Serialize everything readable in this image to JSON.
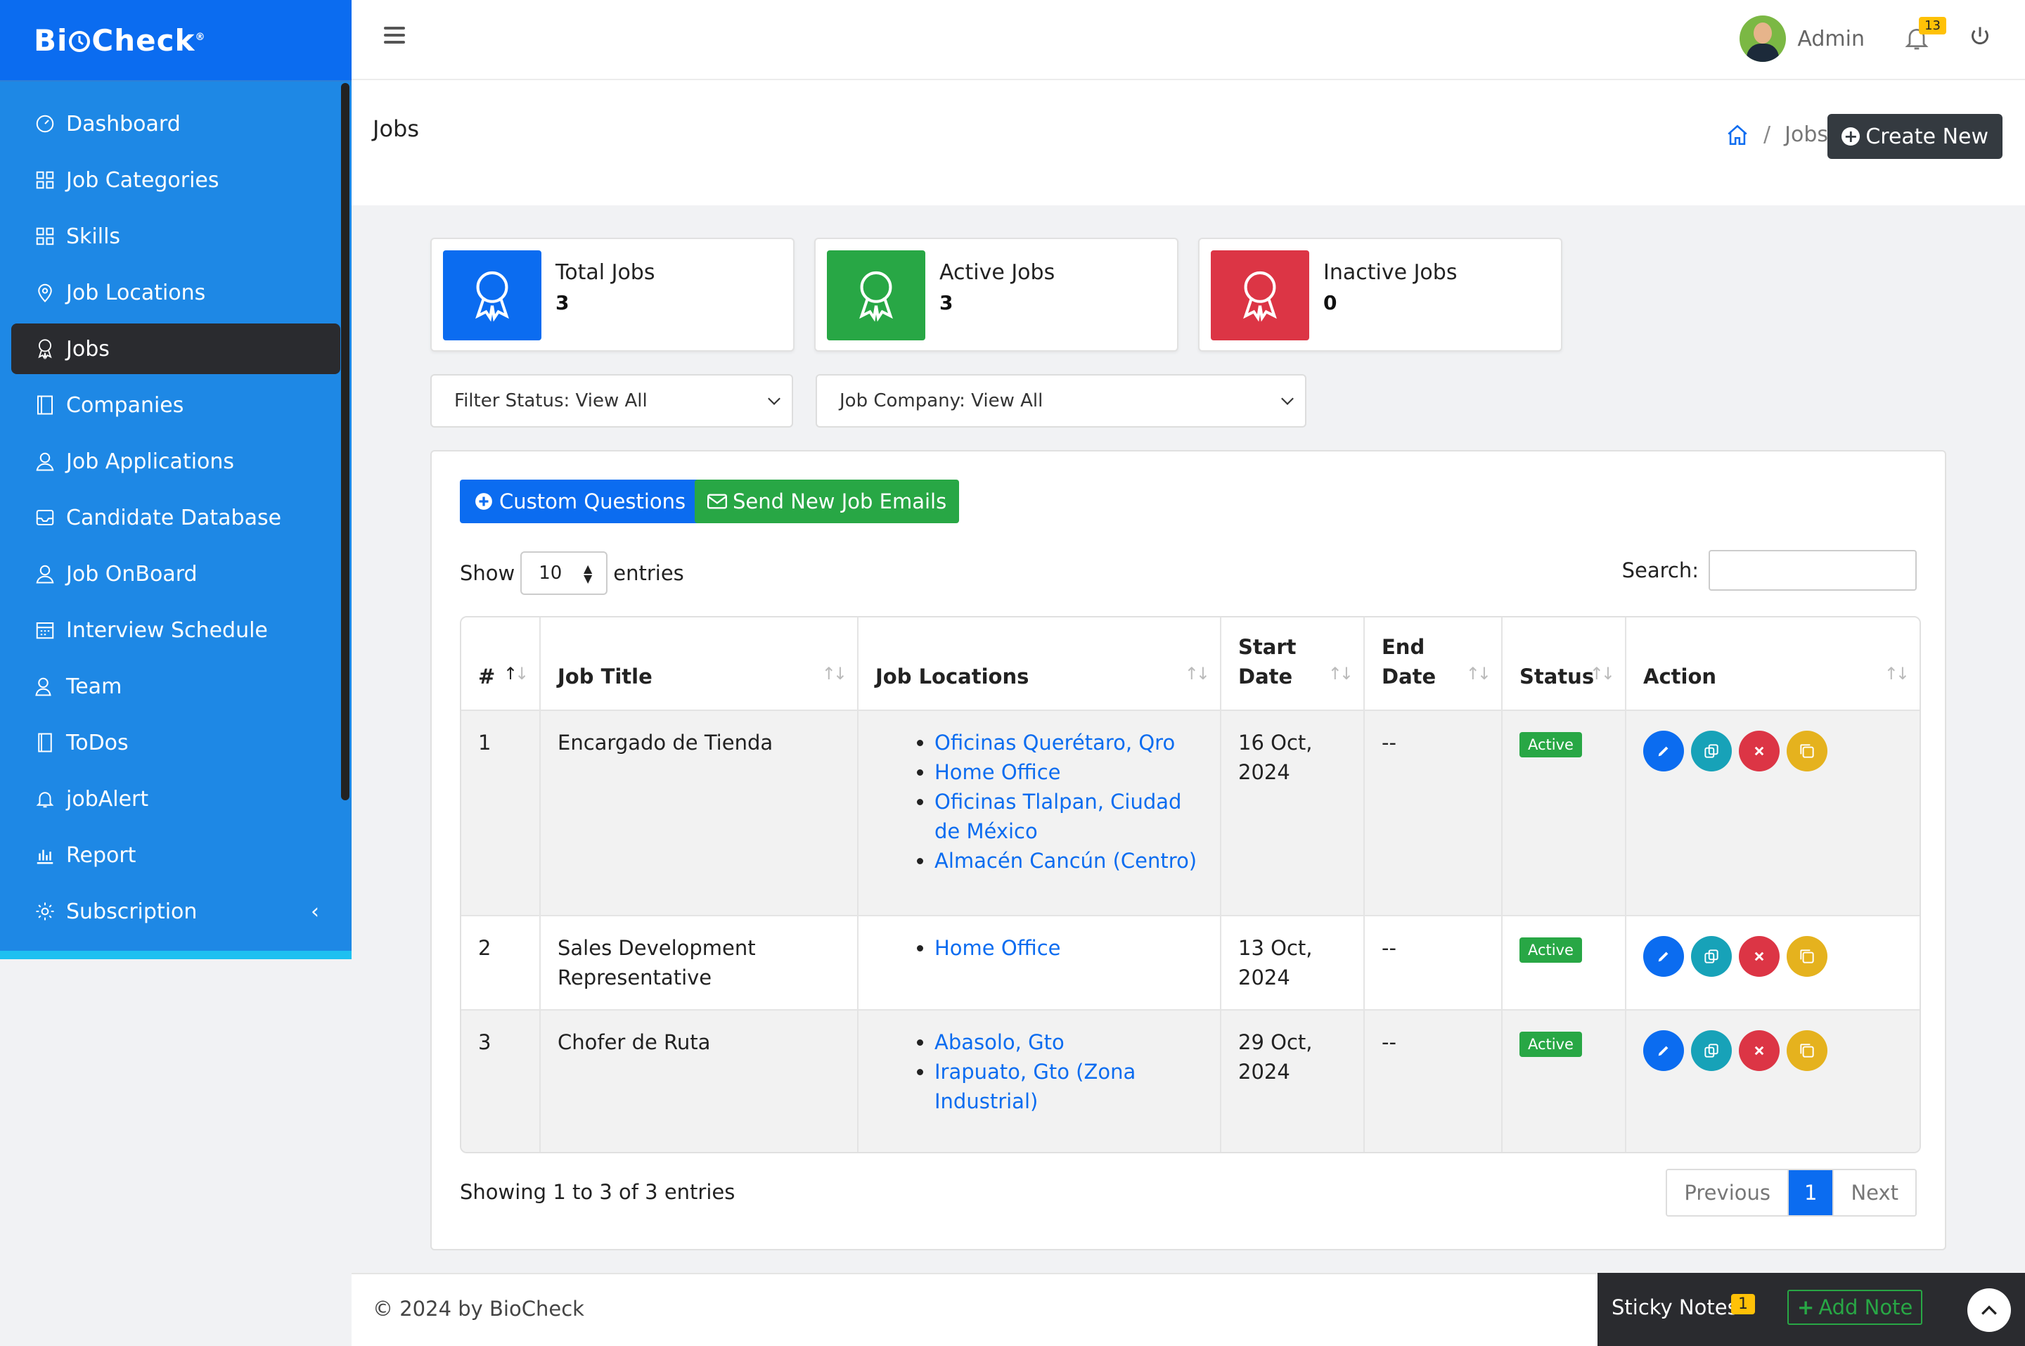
{
  "brand": {
    "name": "BiCheck",
    "logo_text_a": "Bi",
    "logo_text_b": "Check",
    "reg": "®"
  },
  "sidebar": {
    "items": [
      {
        "label": "Dashboard",
        "icon": "gauge-icon"
      },
      {
        "label": "Job Categories",
        "icon": "grid-icon"
      },
      {
        "label": "Skills",
        "icon": "grid-icon"
      },
      {
        "label": "Job Locations",
        "icon": "map-pin-icon"
      },
      {
        "label": "Jobs",
        "icon": "award-icon"
      },
      {
        "label": "Companies",
        "icon": "building-icon"
      },
      {
        "label": "Job Applications",
        "icon": "user-icon"
      },
      {
        "label": "Candidate Database",
        "icon": "inbox-icon"
      },
      {
        "label": "Job OnBoard",
        "icon": "user-icon"
      },
      {
        "label": "Interview Schedule",
        "icon": "calendar-icon"
      },
      {
        "label": "Team",
        "icon": "users-icon"
      },
      {
        "label": "ToDos",
        "icon": "book-icon"
      },
      {
        "label": "jobAlert",
        "icon": "bell-icon"
      },
      {
        "label": "Report",
        "icon": "bar-chart-icon"
      },
      {
        "label": "Subscription",
        "icon": "gear-icon"
      }
    ],
    "chevron": "‹"
  },
  "header": {
    "user_name": "Admin",
    "notification_count": "13"
  },
  "page": {
    "title": "Jobs",
    "breadcrumb_current": "Jobs",
    "breadcrumb_sep": "/",
    "create_label": "Create New"
  },
  "stats": [
    {
      "label": "Total Jobs",
      "value": "3",
      "color": "#0b6cf0"
    },
    {
      "label": "Active Jobs",
      "value": "3",
      "color": "#28a745"
    },
    {
      "label": "Inactive Jobs",
      "value": "0",
      "color": "#dc3545"
    }
  ],
  "filters": {
    "status": "Filter Status: View All",
    "company": "Job Company: View All"
  },
  "actions": {
    "custom_questions": "Custom Questions",
    "send_emails": "Send New Job Emails"
  },
  "table_controls": {
    "show_label": "Show",
    "page_size": "10",
    "entries_label": "entries",
    "search_label": "Search:"
  },
  "table": {
    "headers": [
      "#",
      "Job Title",
      "Job Locations",
      "Start Date",
      "End Date",
      "Status",
      "Action"
    ],
    "rows": [
      {
        "num": "1",
        "title": "Encargado de Tienda",
        "locations": [
          "Oficinas Querétaro, Qro",
          "Home Office",
          "Oficinas Tlalpan, Ciudad de México",
          "Almacén Cancún (Centro)"
        ],
        "start": "16 Oct, 2024",
        "end": "--",
        "status": "Active"
      },
      {
        "num": "2",
        "title": "Sales Development Representative",
        "locations": [
          "Home Office"
        ],
        "start": "13 Oct, 2024",
        "end": "--",
        "status": "Active"
      },
      {
        "num": "3",
        "title": "Chofer de Ruta",
        "locations": [
          "Abasolo, Gto",
          "Irapuato, Gto (Zona Industrial)"
        ],
        "start": "29 Oct, 2024",
        "end": "--",
        "status": "Active"
      }
    ]
  },
  "pagination": {
    "summary": "Showing 1 to 3 of 3 entries",
    "previous": "Previous",
    "current": "1",
    "next": "Next"
  },
  "footer": {
    "copyright": "© 2024 by BioCheck",
    "sticky_label": "Sticky Notes",
    "sticky_count": "1",
    "add_note": "Add Note"
  }
}
